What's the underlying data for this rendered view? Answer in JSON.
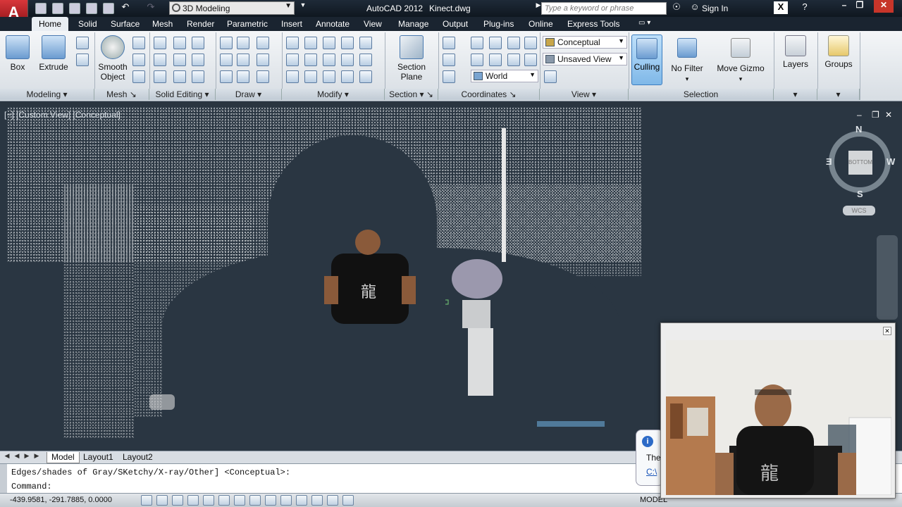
{
  "app": {
    "logo_letter": "A",
    "title": "AutoCAD 2012",
    "file": "Kinect.dwg",
    "workspace": "3D Modeling",
    "search_placeholder": "Type a keyword or phrase",
    "signin": "Sign In"
  },
  "tabs": [
    "Home",
    "Solid",
    "Surface",
    "Mesh",
    "Render",
    "Parametric",
    "Insert",
    "Annotate",
    "View",
    "Manage",
    "Output",
    "Plug-ins",
    "Online",
    "Express Tools"
  ],
  "ribbon": {
    "modeling": {
      "label": "Modeling",
      "box": "Box",
      "extrude": "Extrude"
    },
    "mesh": {
      "label": "Mesh",
      "smooth_object_1": "Smooth",
      "smooth_object_2": "Object"
    },
    "solid_editing": {
      "label": "Solid Editing"
    },
    "draw": {
      "label": "Draw"
    },
    "modify": {
      "label": "Modify"
    },
    "section": {
      "label": "Section",
      "plane_1": "Section",
      "plane_2": "Plane"
    },
    "coordinates": {
      "label": "Coordinates",
      "world": "World"
    },
    "view": {
      "label": "View",
      "visual_style": "Conceptual",
      "saved_view": "Unsaved View"
    },
    "selection": {
      "label": "Selection",
      "culling": "Culling",
      "no_filter": "No Filter",
      "move_gizmo": "Move Gizmo"
    },
    "layers": {
      "label": "Layers"
    },
    "groups": {
      "label": "Groups"
    }
  },
  "viewport": {
    "label": "[−] [Custom View] [Conceptual]",
    "viewcube_face": "BOTTOM",
    "compass_n": "N",
    "compass_s": "S",
    "compass_e": "E",
    "compass_w": "W",
    "wcs": "WCS"
  },
  "layout_tabs": [
    "Model",
    "Layout1",
    "Layout2"
  ],
  "command": {
    "history": "Edges/shades of Gray/SKetchy/X-ray/Other] <Conceptual>:",
    "prompt": "Command:"
  },
  "status": {
    "coordinates": "-439.9581, -291.7885, 0.0000",
    "model": "MODEL"
  },
  "bubble": {
    "icon": "i",
    "text": "The",
    "link": "C:\\"
  },
  "colors": {
    "viewport_bg": "#2a3642",
    "titlebar_bg": "#0f1720",
    "ribbon_bg": "#dfe4ea",
    "accent_red": "#c8282c"
  }
}
